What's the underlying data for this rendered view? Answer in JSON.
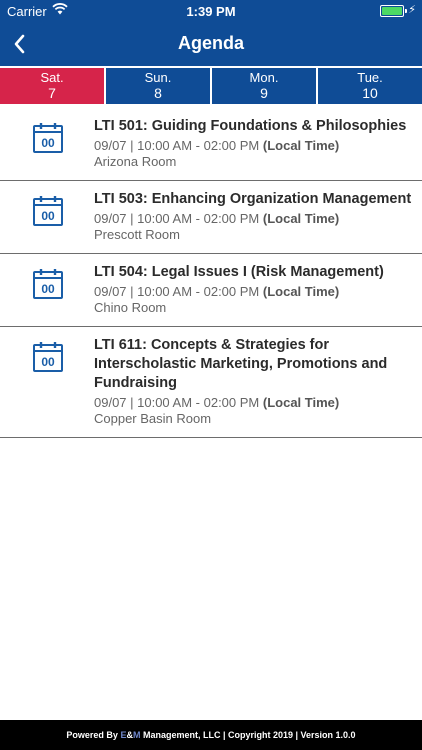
{
  "status_bar": {
    "carrier": "Carrier",
    "time": "1:39 PM"
  },
  "nav": {
    "title": "Agenda"
  },
  "days": [
    {
      "name": "Sat.",
      "number": "7",
      "selected": true
    },
    {
      "name": "Sun.",
      "number": "8",
      "selected": false
    },
    {
      "name": "Mon.",
      "number": "9",
      "selected": false
    },
    {
      "name": "Tue.",
      "number": "10",
      "selected": false
    }
  ],
  "sessions": [
    {
      "icon_text": "00",
      "title": "LTI 501: Guiding Foundations & Philosophies",
      "time": "09/07 | 10:00 AM - 02:00 PM",
      "time_note": "(Local Time)",
      "room": "Arizona Room"
    },
    {
      "icon_text": "00",
      "title": "LTI 503: Enhancing Organization Management",
      "time": "09/07 | 10:00 AM - 02:00 PM",
      "time_note": "(Local Time)",
      "room": "Prescott Room"
    },
    {
      "icon_text": "00",
      "title": "LTI 504: Legal Issues I (Risk Management)",
      "time": "09/07 | 10:00 AM - 02:00 PM",
      "time_note": "(Local Time)",
      "room": "Chino Room"
    },
    {
      "icon_text": "00",
      "title": "LTI 611: Concepts & Strategies for Interscholastic Marketing, Promotions and Fundraising",
      "time": "09/07 | 10:00 AM - 02:00 PM",
      "time_note": "(Local Time)",
      "room": "Copper Basin Room"
    }
  ],
  "footer": {
    "prefix": "Powered By ",
    "brand_e": "E",
    "brand_amp": "&",
    "brand_m": "M",
    "suffix": " Management, LLC | Copyright 2019 | Version 1.0.0"
  },
  "colors": {
    "primary": "#0f4c96",
    "selected_day": "#d6244a",
    "icon": "#1a5ea8"
  }
}
